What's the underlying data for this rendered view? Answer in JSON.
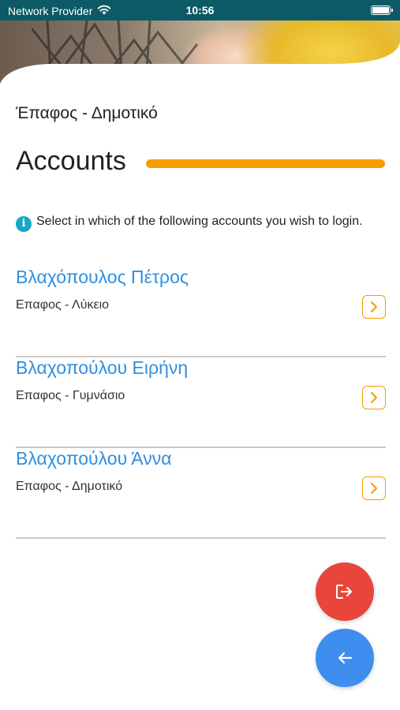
{
  "status_bar": {
    "carrier": "Network Provider",
    "time": "10:56",
    "wifi_icon": "wifi-icon",
    "battery_icon": "battery-icon"
  },
  "header": {
    "school_name": "Έπαφος - Δημοτικό"
  },
  "section": {
    "title": "Accounts",
    "accent_color": "#f59c00"
  },
  "info": {
    "icon": "info-icon",
    "icon_color": "#1aa6c8",
    "text": "Select in which of the following accounts you wish to login."
  },
  "accounts": [
    {
      "name": "Βλαχόπουλος Πέτρος",
      "school": "Επαφος - Λύκειο"
    },
    {
      "name": "Βλαχοπούλου Ειρήνη",
      "school": "Επαφος - Γυμνάσιο"
    },
    {
      "name": "Βλαχοπούλου Άννα",
      "school": "Επαφος - Δημοτικό"
    }
  ],
  "colors": {
    "status_bar": "#0b5a66",
    "account_name": "#2f8fe0",
    "logout_button": "#e8463b",
    "back_button": "#3e8ef0"
  },
  "actions": {
    "logout_icon": "logout-icon",
    "back_icon": "arrow-left-icon"
  }
}
